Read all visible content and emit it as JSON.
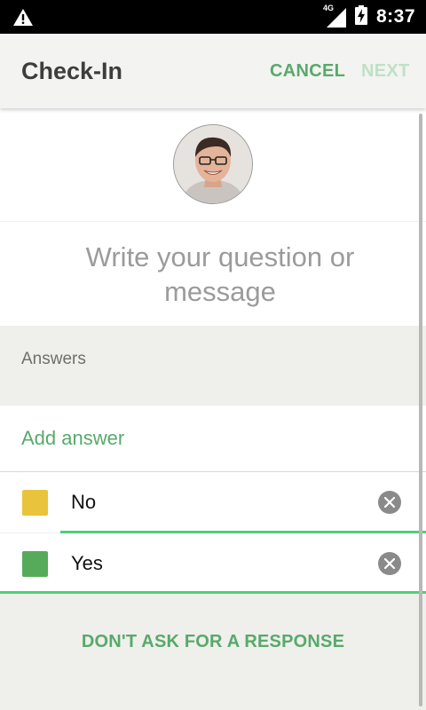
{
  "status_bar": {
    "time": "8:37",
    "network": "4G",
    "icons": [
      "warning-icon",
      "signal-icon",
      "battery-charging-icon"
    ]
  },
  "app_bar": {
    "title": "Check-In",
    "cancel_label": "CANCEL",
    "next_label": "NEXT"
  },
  "question": {
    "placeholder": "Write your question or message"
  },
  "answers": {
    "section_label": "Answers",
    "add_label": "Add answer",
    "items": [
      {
        "label": "No",
        "color": "#e9c33b",
        "remove_icon": "clear-icon"
      },
      {
        "label": "Yes",
        "color": "#56ab5a",
        "remove_icon": "clear-icon"
      }
    ]
  },
  "footer": {
    "dont_ask_label": "DON'T ASK FOR A RESPONSE"
  },
  "colors": {
    "accent": "#58a96b",
    "accent_disabled": "#bfe0c6",
    "input_underline": "#4fcf78"
  }
}
